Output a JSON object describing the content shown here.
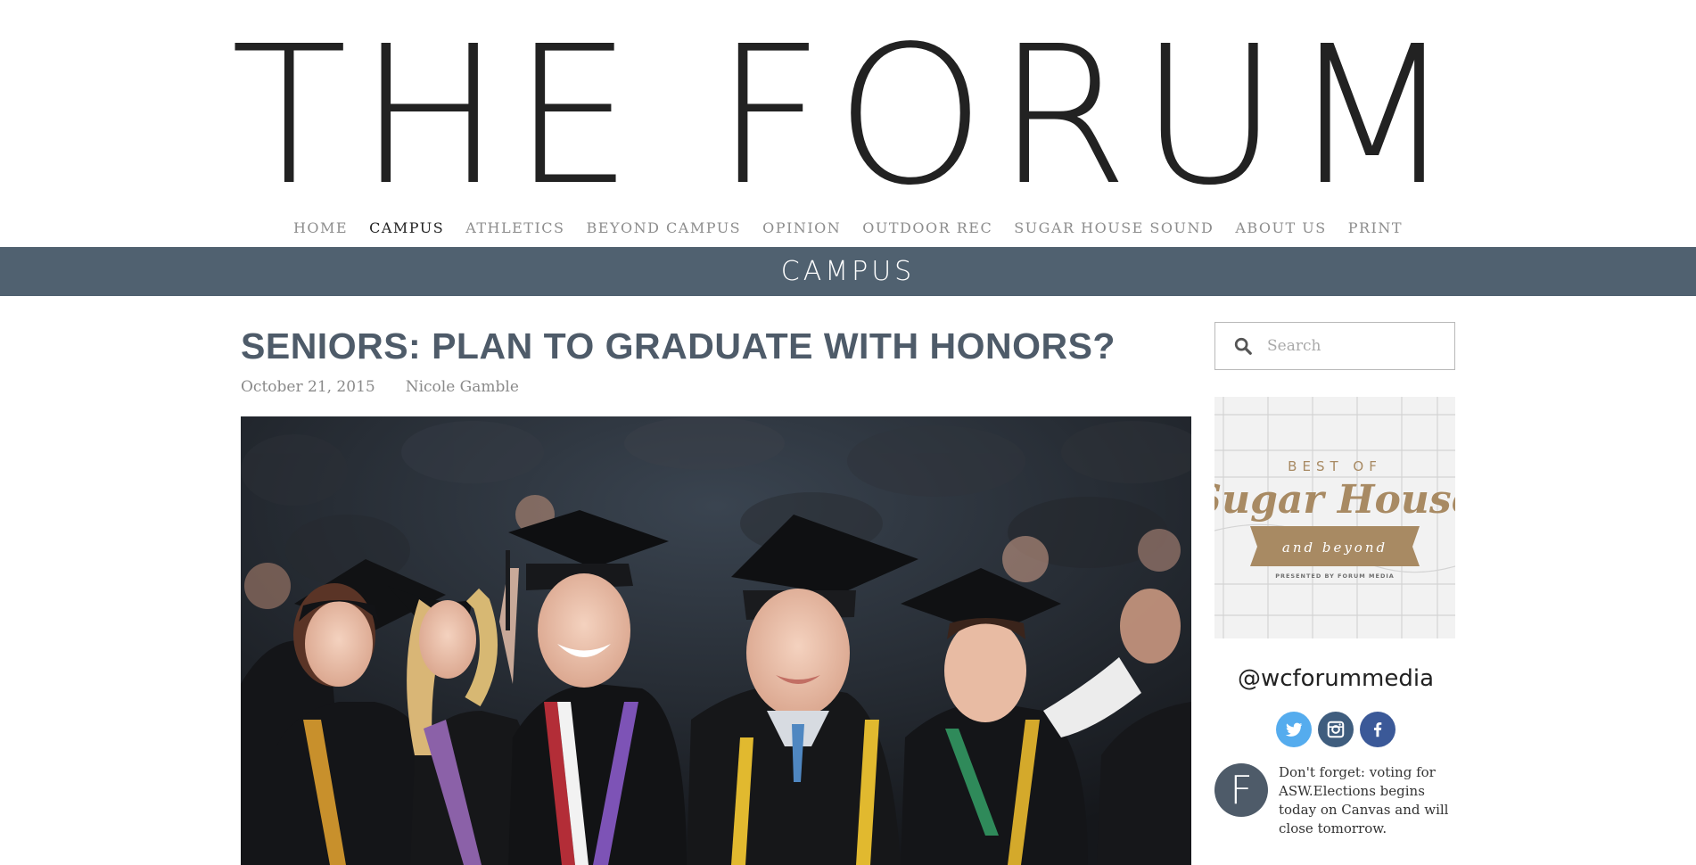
{
  "site": {
    "title": "THE FORUM"
  },
  "nav": {
    "items": [
      {
        "label": "HOME",
        "active": false
      },
      {
        "label": "CAMPUS",
        "active": true
      },
      {
        "label": "ATHLETICS",
        "active": false
      },
      {
        "label": "BEYOND CAMPUS",
        "active": false
      },
      {
        "label": "OPINION",
        "active": false
      },
      {
        "label": "OUTDOOR REC",
        "active": false
      },
      {
        "label": "SUGAR HOUSE SOUND",
        "active": false
      },
      {
        "label": "ABOUT US",
        "active": false
      },
      {
        "label": "PRINT",
        "active": false
      }
    ]
  },
  "section": {
    "title": "CAMPUS",
    "band_color": "#506170"
  },
  "article": {
    "headline": "SENIORS: PLAN TO GRADUATE WITH HONORS?",
    "date": "October 21, 2015",
    "author": "Nicole Gamble",
    "image_desc": "graduation-photo"
  },
  "sidebar": {
    "search": {
      "placeholder": "Search",
      "value": ""
    },
    "promo": {
      "line1": "BEST OF",
      "line2": "Sugar House",
      "line3": "and beyond",
      "line4": "PRESENTED BY FORUM MEDIA",
      "color": "#a88a63"
    },
    "handle": "@wcforummedia",
    "socials": [
      {
        "name": "twitter-icon",
        "color": "#55acee"
      },
      {
        "name": "instagram-icon",
        "color": "#3f5d7e"
      },
      {
        "name": "facebook-icon",
        "color": "#3b5998"
      }
    ],
    "tweet": {
      "avatar_letter": "F",
      "text": "Don't forget: voting for ASW.Elections begins today on Canvas and will close tomorrow."
    }
  },
  "colors": {
    "headline": "#4e5b69",
    "nav_inactive": "#8d8d8d",
    "nav_active": "#222222"
  }
}
